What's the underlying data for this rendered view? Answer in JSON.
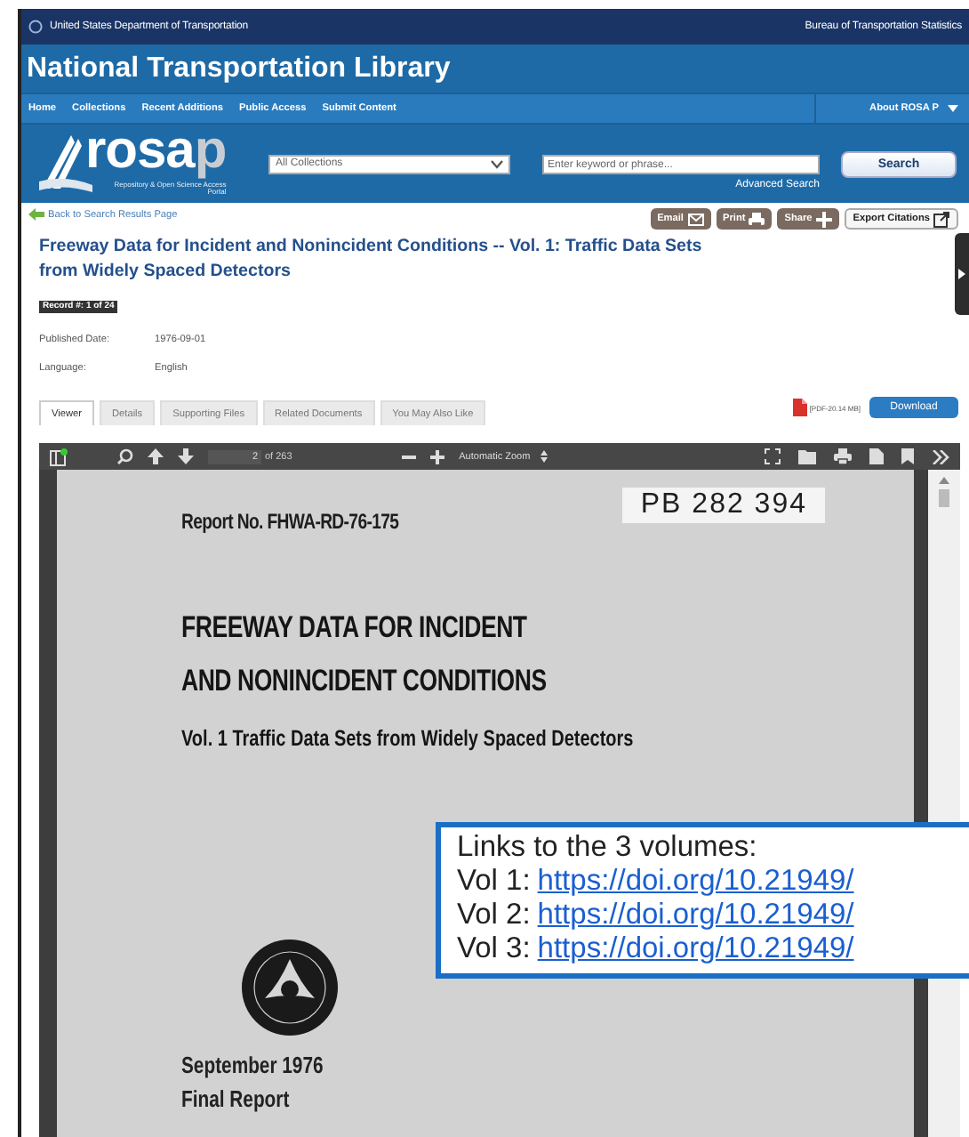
{
  "top_bar": {
    "left": "United States Department of Transportation",
    "right": "Bureau of Transportation Statistics"
  },
  "site_title": "National Transportation Library",
  "nav": {
    "items": [
      "Home",
      "Collections",
      "Recent Additions",
      "Public Access",
      "Submit Content"
    ],
    "about": "About ROSA P"
  },
  "header": {
    "logo": {
      "main": "rosa",
      "accent": "p",
      "tagline": "Repository & Open Science Access Portal"
    },
    "collection_select": "All Collections",
    "search": {
      "placeholder": "Enter keyword or phrase..."
    },
    "search_button": "Search",
    "advanced_link": "Advanced Search"
  },
  "back_link": "Back to Search Results Page",
  "actions": [
    {
      "label": "Email",
      "kind": "email"
    },
    {
      "label": "Print",
      "kind": "print"
    },
    {
      "label": "Share",
      "kind": "share"
    },
    {
      "label": "Export Citations",
      "kind": "export"
    }
  ],
  "record": {
    "title": "Freeway Data for Incident and Nonincident Conditions -- Vol. 1: Traffic Data Sets from Widely Spaced Detectors",
    "badge": "Record #: 1 of 24",
    "fields": [
      {
        "label": "Published Date:",
        "value": "1976-09-01"
      },
      {
        "label": "Language:",
        "value": "English"
      }
    ]
  },
  "tabs": [
    {
      "label": "Viewer",
      "selected": true
    },
    {
      "label": "Details",
      "selected": false
    },
    {
      "label": "Supporting Files",
      "selected": false
    },
    {
      "label": "Related Documents",
      "selected": false
    },
    {
      "label": "You May Also Like",
      "selected": false
    }
  ],
  "file_info": "[PDF-20.14 MB]",
  "download_button": "Download",
  "viewer": {
    "page": "2",
    "page_count": "of 263",
    "zoom": "Automatic Zoom",
    "document": {
      "stamp": "PB 282 394",
      "report_no": "Report No. FHWA-RD-76-175",
      "title_lines": [
        "FREEWAY DATA FOR INCIDENT",
        "AND NONINCIDENT CONDITIONS"
      ],
      "subtitle": "Vol. 1  Traffic Data Sets from Widely Spaced Detectors",
      "date": "September 1976",
      "report_type": "Final Report"
    }
  },
  "callout": {
    "heading": "Links to the 3 volumes:",
    "links": [
      {
        "label": "Vol 1:",
        "url": "https://doi.org/10.21949/"
      },
      {
        "label": "Vol 2:",
        "url": "https://doi.org/10.21949/"
      },
      {
        "label": "Vol 3:",
        "url": "https://doi.org/10.21949/"
      }
    ]
  }
}
